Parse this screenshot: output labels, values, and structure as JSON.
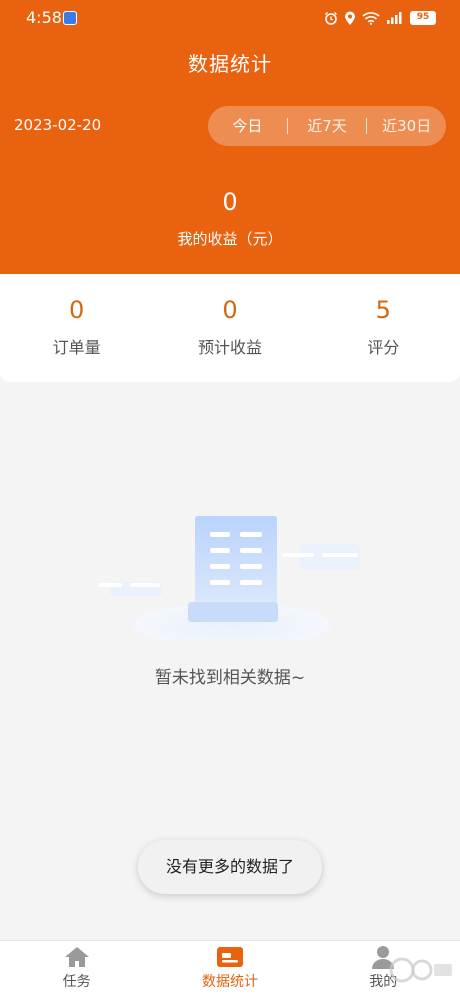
{
  "status_bar": {
    "time": "4:58",
    "battery": "95",
    "icons": [
      "alarm-icon",
      "location-icon",
      "wifi-icon",
      "signal-icon"
    ]
  },
  "header": {
    "title": "数据统计",
    "date": "2023-02-20",
    "range_tabs": [
      {
        "label": "今日",
        "active": true
      },
      {
        "label": "近7天",
        "active": false
      },
      {
        "label": "近30日",
        "active": false
      }
    ],
    "income_value": "0",
    "income_label": "我的收益（元）"
  },
  "stats": [
    {
      "value": "0",
      "label": "订单量"
    },
    {
      "value": "0",
      "label": "预计收益"
    },
    {
      "value": "5",
      "label": "评分"
    }
  ],
  "empty_state": {
    "text": "暂未找到相关数据~"
  },
  "toast": {
    "text": "没有更多的数据了"
  },
  "bottom_nav": [
    {
      "label": "任务",
      "icon": "home-icon",
      "active": false
    },
    {
      "label": "数据统计",
      "icon": "stats-card-icon",
      "active": true
    },
    {
      "label": "我的",
      "icon": "user-icon",
      "active": false
    }
  ],
  "colors": {
    "primary": "#e8620f",
    "stat_value": "#d26a10",
    "background": "#f4f4f4"
  }
}
